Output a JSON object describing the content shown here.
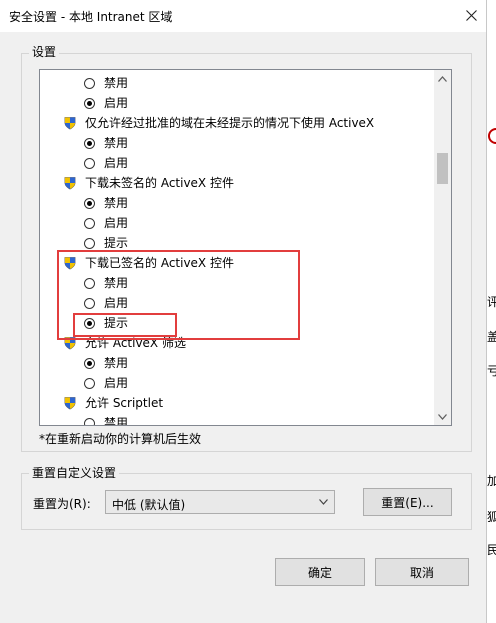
{
  "window": {
    "title": "安全设置 - 本地 Intranet 区域"
  },
  "settings_group": {
    "label": "设置"
  },
  "settings_list": [
    {
      "kind": "option",
      "label": "禁用",
      "checked": false
    },
    {
      "kind": "option",
      "label": "启用",
      "checked": true
    },
    {
      "kind": "heading",
      "label": "仅允许经过批准的域在未经提示的情况下使用 ActiveX"
    },
    {
      "kind": "option",
      "label": "禁用",
      "checked": true
    },
    {
      "kind": "option",
      "label": "启用",
      "checked": false
    },
    {
      "kind": "heading",
      "label": "下载未签名的 ActiveX 控件"
    },
    {
      "kind": "option",
      "label": "禁用",
      "checked": true
    },
    {
      "kind": "option",
      "label": "启用",
      "checked": false
    },
    {
      "kind": "option",
      "label": "提示",
      "checked": false
    },
    {
      "kind": "heading",
      "label": "下载已签名的 ActiveX 控件"
    },
    {
      "kind": "option",
      "label": "禁用",
      "checked": false
    },
    {
      "kind": "option",
      "label": "启用",
      "checked": false
    },
    {
      "kind": "option",
      "label": "提示",
      "checked": true
    },
    {
      "kind": "heading",
      "label": "允许 ActiveX 筛选"
    },
    {
      "kind": "option",
      "label": "禁用",
      "checked": true
    },
    {
      "kind": "option",
      "label": "启用",
      "checked": false
    },
    {
      "kind": "heading",
      "label": "允许 Scriptlet"
    },
    {
      "kind": "option",
      "label": "禁用",
      "checked": false
    }
  ],
  "restart_note": "*在重新启动你的计算机后生效",
  "reset_group": {
    "label": "重置自定义设置",
    "reset_to_label": "重置为(R):",
    "level_value": "中低 (默认值)",
    "reset_button": "重置(E)..."
  },
  "buttons": {
    "ok": "确定",
    "cancel": "取消"
  },
  "background_fragments": [
    "评",
    "盖",
    "亏",
    "加",
    "狐",
    "民"
  ]
}
